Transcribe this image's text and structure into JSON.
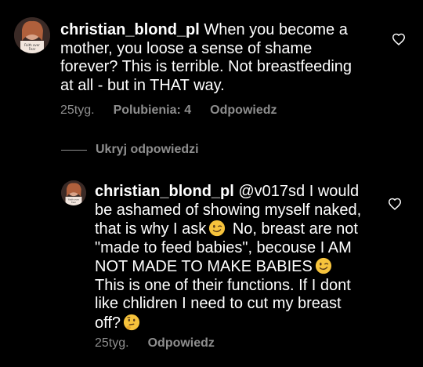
{
  "colors": {
    "background": "#000000",
    "text": "#ffffff",
    "secondary": "#8e8e8e",
    "emoji_face": "#F6C33C"
  },
  "comment1": {
    "username": "christian_blond_pl",
    "text": "When you become a mother, you loose a sense of shame forever? This is terrible. Not breastfeeding at all - but in THAT way.",
    "time": "25tyg.",
    "likes": "Polubienia: 4",
    "reply": "Odpowiedz",
    "icons": [
      "avatar",
      "heart-icon"
    ]
  },
  "hide_replies": {
    "label": "Ukryj odpowiedzi"
  },
  "comment2": {
    "username": "christian_blond_pl",
    "mention": "@v017sd",
    "text_part1": "I would be ashamed of showing myself naked, that is why I ask",
    "text_part2": "No, breast are not \"made to feed babies\", becouse I AM NOT MADE TO MAKE BABIES",
    "text_part3": "This is one of their functions. If I dont like chlidren I need to cut my breast off?",
    "time": "25tyg.",
    "reply": "Odpowiedz",
    "icons": [
      "avatar",
      "winking-face-icon",
      "winking-face-icon",
      "thinking-face-icon",
      "heart-icon"
    ]
  }
}
